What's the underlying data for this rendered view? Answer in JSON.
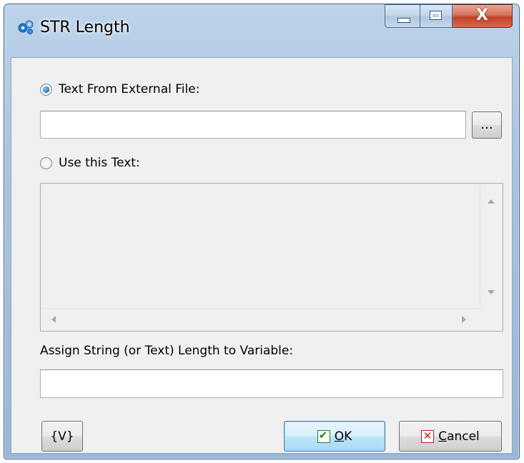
{
  "window": {
    "title": "STR Length",
    "close_glyph": "X"
  },
  "options": {
    "external_file_label": "Text From External File:",
    "external_file_selected": true,
    "file_path_value": "",
    "browse_label": "...",
    "use_text_label": "Use this Text:",
    "use_text_selected": false,
    "text_value": ""
  },
  "assign": {
    "label": "Assign String (or Text) Length to Variable:",
    "variable_value": ""
  },
  "buttons": {
    "variables_label": "{V}",
    "ok_mnemonic": "O",
    "ok_rest": "K",
    "cancel_mnemonic": "C",
    "cancel_rest": "ancel"
  },
  "icons": {
    "app": "gears-icon",
    "browse": "ellipsis-icon",
    "ok": "checkmark-icon",
    "cancel": "x-icon"
  },
  "colors": {
    "title_bar": "#a7c3e0",
    "close_button": "#c0402a",
    "dialog_background": "#f0f0f0",
    "ok_check": "#1d8a1d",
    "cancel_x": "#d21a1a"
  }
}
